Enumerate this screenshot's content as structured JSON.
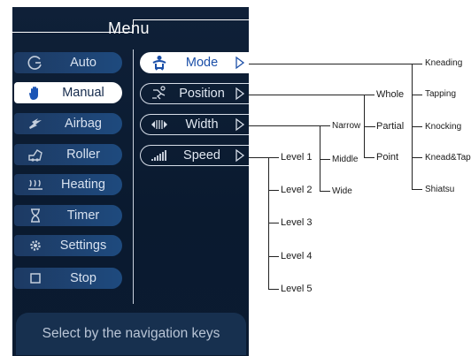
{
  "menu": {
    "title": "Menu",
    "left_items": [
      {
        "label": "Auto",
        "icon": "auto-icon"
      },
      {
        "label": "Manual",
        "icon": "hand-icon"
      },
      {
        "label": "Airbag",
        "icon": "airbag-icon"
      },
      {
        "label": "Roller",
        "icon": "roller-icon"
      },
      {
        "label": "Heating",
        "icon": "heating-icon"
      },
      {
        "label": "Timer",
        "icon": "timer-icon"
      },
      {
        "label": "Settings",
        "icon": "gear-icon"
      },
      {
        "label": "Stop",
        "icon": "stop-icon"
      }
    ],
    "active_left": "Manual",
    "right_items": [
      {
        "label": "Mode",
        "icon": "seated-person-icon"
      },
      {
        "label": "Position",
        "icon": "body-position-icon"
      },
      {
        "label": "Width",
        "icon": "width-icon"
      },
      {
        "label": "Speed",
        "icon": "speed-bars-icon"
      }
    ],
    "active_right": "Mode",
    "hint": "Select by the navigation keys"
  },
  "tree": {
    "mode_options": [
      "Kneading",
      "Tapping",
      "Knocking",
      "Knead&Tap",
      "Shiatsu"
    ],
    "position_options": [
      "Whole",
      "Partial",
      "Point"
    ],
    "width_options": [
      "Narrow",
      "Middle",
      "Wide"
    ],
    "speed_options": [
      "Level 1",
      "Level 2",
      "Level 3",
      "Level 4",
      "Level 5"
    ]
  },
  "colors": {
    "panel_bg": "#0f2038",
    "button_blue": "#1e4a7e",
    "active_text": "#1b4fa8",
    "line": "#222222"
  }
}
